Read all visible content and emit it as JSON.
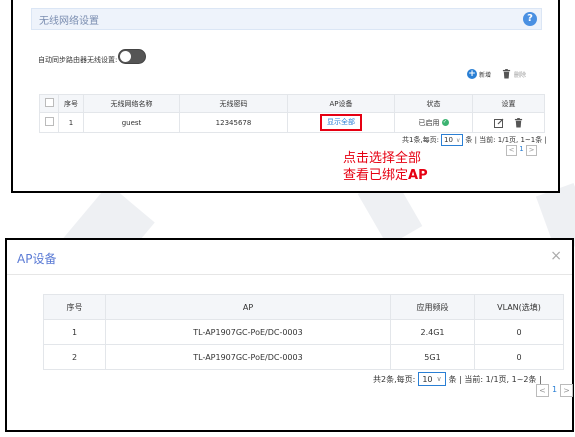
{
  "wireless": {
    "title": "无线网络设置",
    "help_icon": "?",
    "sync_label": "自动同步路由器无线设置:",
    "sync_on": false,
    "actions": {
      "new": "新增",
      "delete": "删除"
    },
    "table": {
      "headers": [
        "",
        "序号",
        "无线网络名称",
        "无线密码",
        "AP设备",
        "状态",
        "设置"
      ],
      "rows": [
        {
          "index": "1",
          "ssid": "guest",
          "password": "12345678",
          "ap": "显示全部",
          "status": "已启用"
        }
      ]
    },
    "pagination": {
      "total": "共1条,每页:",
      "per_page": "10",
      "suffix": "条 | 当前: 1/1页, 1~1条 |",
      "page": "1",
      "prev": "<",
      "next": ">"
    },
    "annotation": {
      "line1": "点击选择全部",
      "line2_prefix": "查看已绑定",
      "line2_bold": "AP"
    }
  },
  "ap_dialog": {
    "title": "AP设备",
    "close": "×",
    "table": {
      "headers": [
        "序号",
        "AP",
        "应用频段",
        "VLAN(选填)"
      ],
      "rows": [
        {
          "index": "1",
          "ap": "TL-AP1907GC-PoE/DC-0003",
          "band": "2.4G1",
          "vlan": "0"
        },
        {
          "index": "2",
          "ap": "TL-AP1907GC-PoE/DC-0003",
          "band": "5G1",
          "vlan": "0"
        }
      ]
    },
    "pagination": {
      "total": "共2条,每页:",
      "per_page": "10",
      "suffix": "条 | 当前: 1/1页, 1~2条 |",
      "page": "1",
      "prev": "<",
      "next": ">"
    }
  },
  "colors": {
    "accent": "#2a7fd4",
    "annotation": "#e60012",
    "status_ok": "#3cb371",
    "dialog_title": "#5b7bd5"
  }
}
